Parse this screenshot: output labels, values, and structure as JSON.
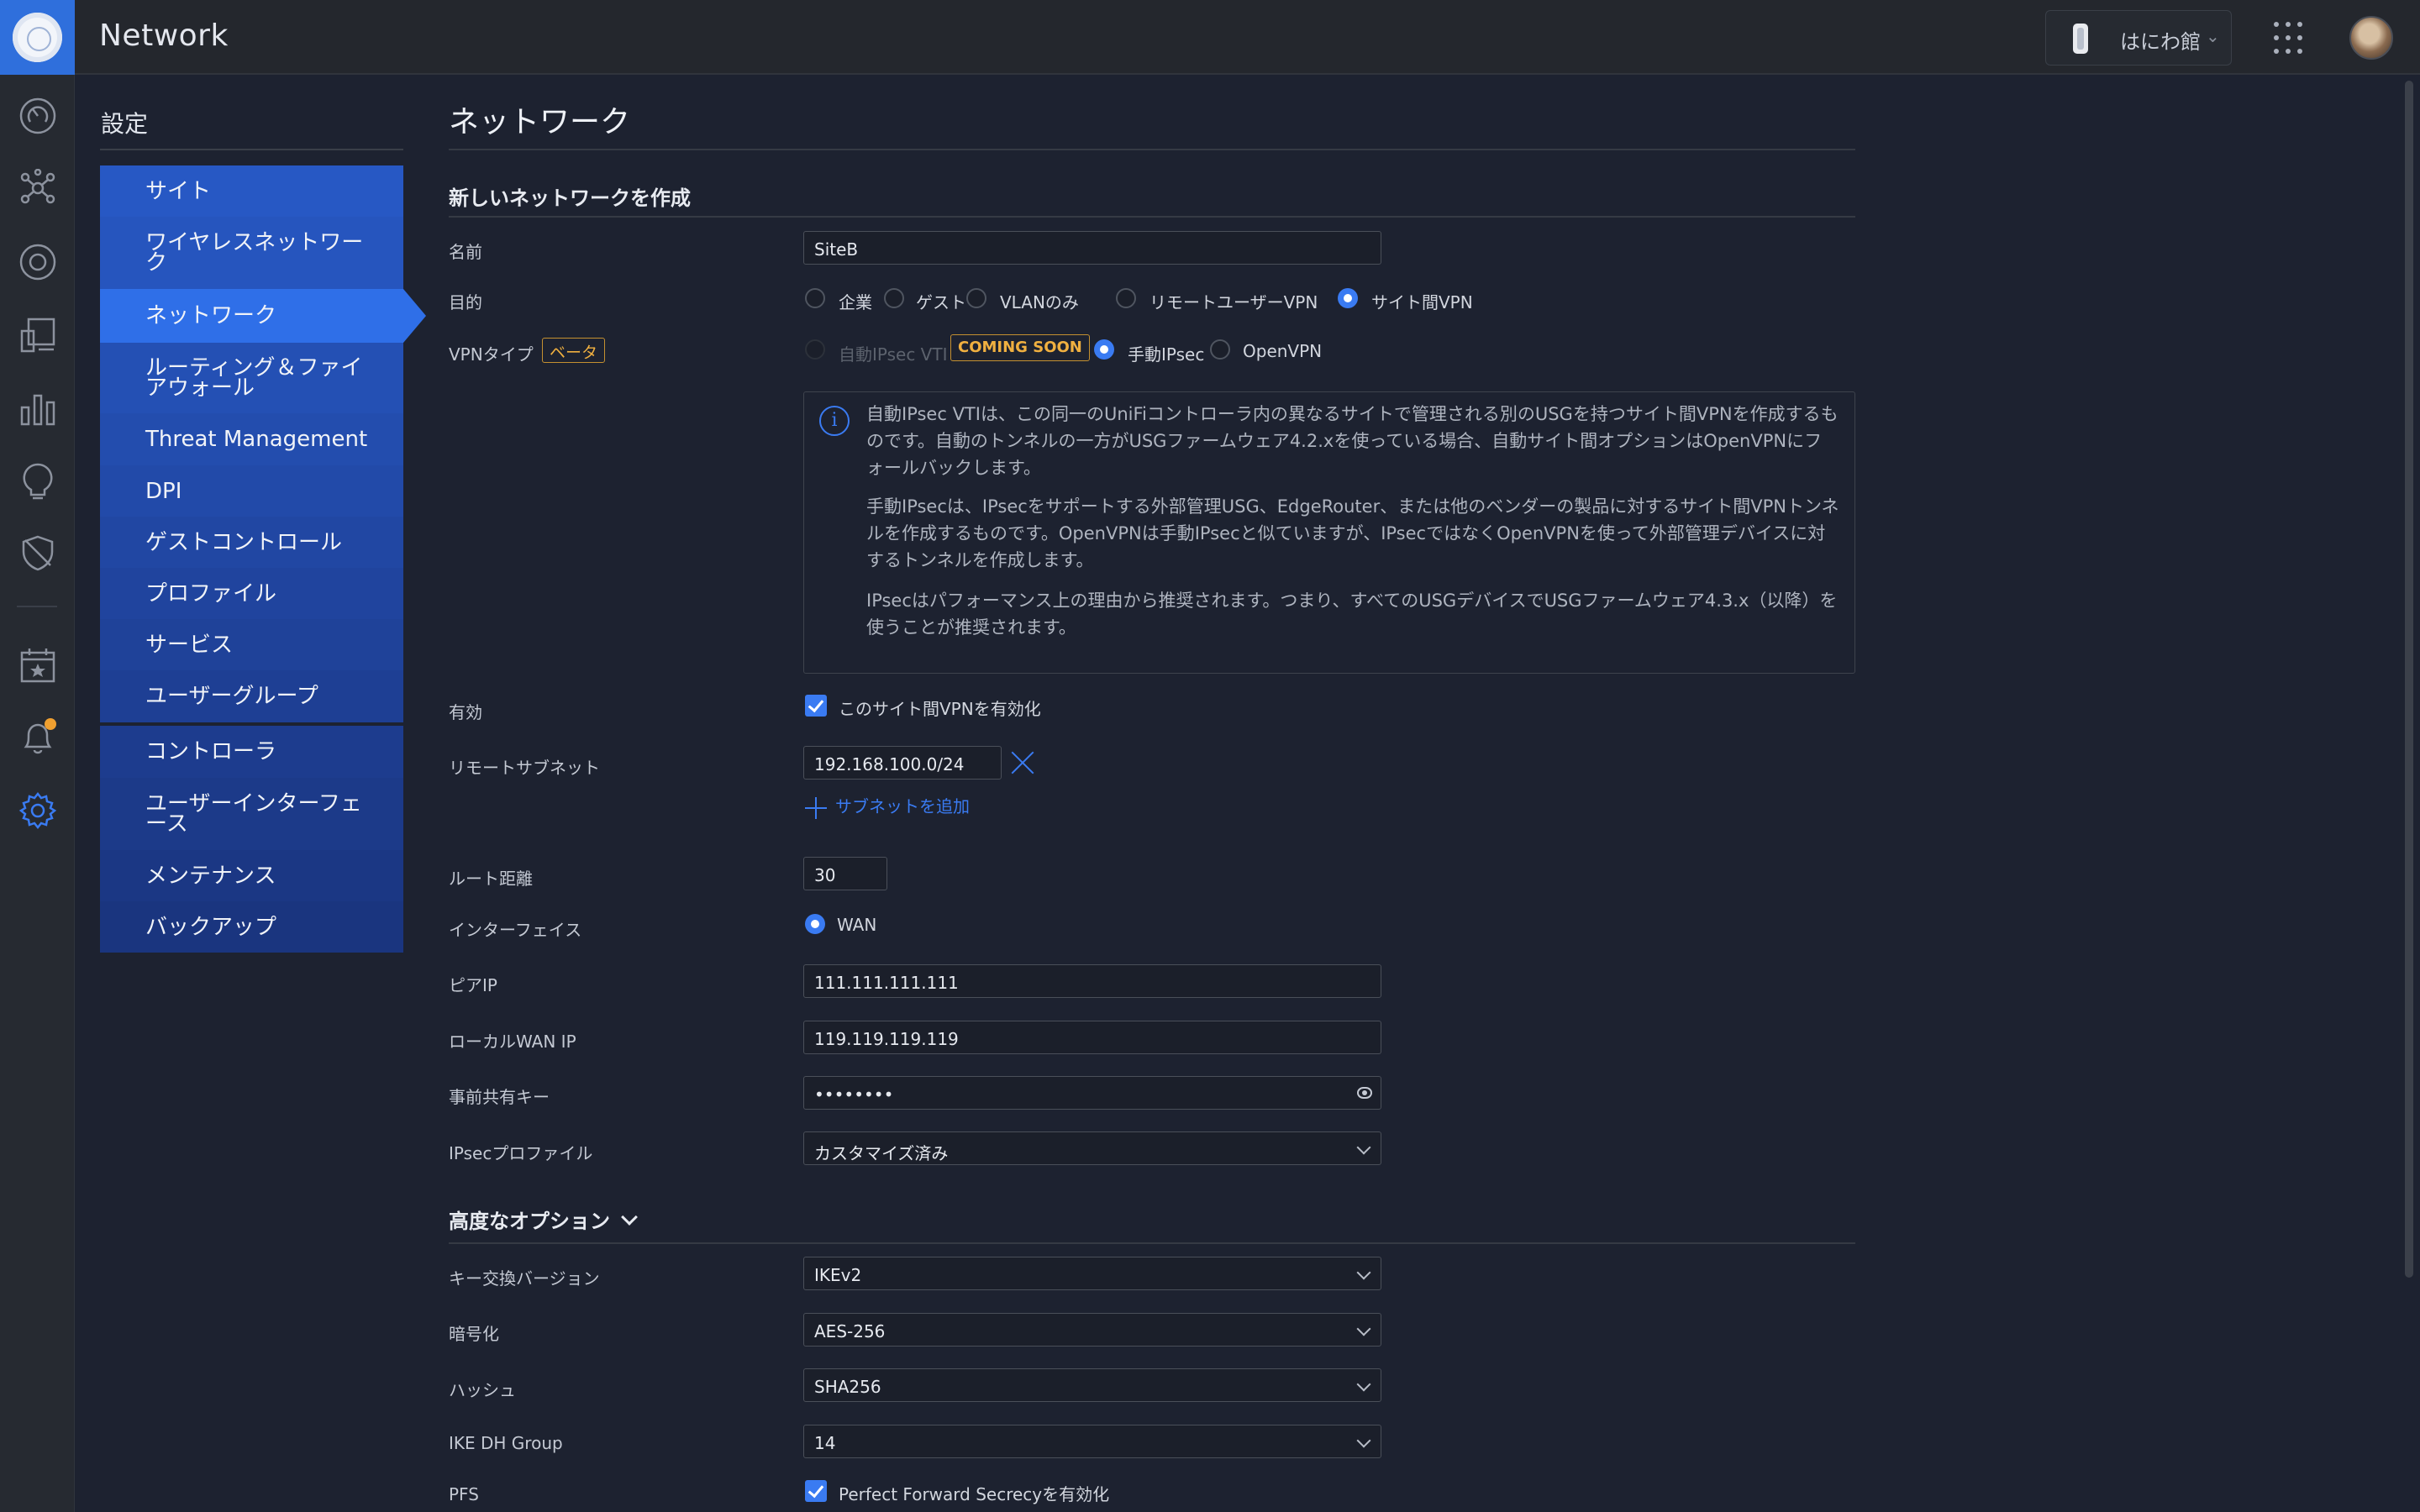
{
  "app": {
    "title": "Network"
  },
  "header": {
    "site_name": "はにわ館",
    "site_chevron": "⌄"
  },
  "settings": {
    "title": "設定"
  },
  "menu": {
    "group1": [
      {
        "label": "サイト"
      },
      {
        "label": "ワイヤレスネットワーク"
      },
      {
        "label": "ネットワーク",
        "active": true
      },
      {
        "label": "ルーティング＆ファイアウォール"
      },
      {
        "label": "Threat Management"
      },
      {
        "label": "DPI"
      },
      {
        "label": "ゲストコントロール"
      },
      {
        "label": "プロファイル"
      },
      {
        "label": "サービス"
      },
      {
        "label": "ユーザーグループ"
      }
    ],
    "group2": [
      {
        "label": "コントローラ"
      },
      {
        "label": "ユーザーインターフェース"
      },
      {
        "label": "メンテナンス"
      },
      {
        "label": "バックアップ"
      }
    ]
  },
  "page": {
    "title": "ネットワーク",
    "section_title": "新しいネットワークを作成"
  },
  "form": {
    "name": {
      "label": "名前",
      "value": "SiteB"
    },
    "purpose": {
      "label": "目的",
      "options": [
        "企業",
        "ゲスト",
        "VLANのみ",
        "リモートユーザーVPN",
        "サイト間VPN"
      ],
      "selected": "サイト間VPN"
    },
    "vpn_type": {
      "label": "VPNタイプ",
      "beta": "ベータ",
      "options": [
        "自動IPsec VTI",
        "手動IPsec",
        "OpenVPN"
      ],
      "coming_soon": "COMING SOON",
      "selected": "手動IPsec"
    },
    "info": {
      "p1": "自動IPsec VTIは、この同一のUniFiコントローラ内の異なるサイトで管理される別のUSGを持つサイト間VPNを作成するものです。自動のトンネルの一方がUSGファームウェア4.2.xを使っている場合、自動サイト間オプションはOpenVPNにフォールバックします。",
      "p2": "手動IPsecは、IPsecをサポートする外部管理USG、EdgeRouter、または他のベンダーの製品に対するサイト間VPNトンネルを作成するものです。OpenVPNは手動IPsecと似ていますが、IPsecではなくOpenVPNを使って外部管理デバイスに対するトンネルを作成します。",
      "p3": "IPsecはパフォーマンス上の理由から推奨されます。つまり、すべてのUSGデバイスでUSGファームウェア4.3.x（以降）を使うことが推奨されます。"
    },
    "enabled": {
      "label": "有効",
      "checkbox_label": "このサイト間VPNを有効化",
      "checked": true
    },
    "remote_subnet": {
      "label": "リモートサブネット",
      "value": "192.168.100.0/24",
      "add_label": "サブネットを追加"
    },
    "route_distance": {
      "label": "ルート距離",
      "value": "30"
    },
    "interface": {
      "label": "インターフェイス",
      "option": "WAN"
    },
    "peer_ip": {
      "label": "ピアIP",
      "value": "111.111.111.111"
    },
    "local_wan_ip": {
      "label": "ローカルWAN IP",
      "value": "119.119.119.119"
    },
    "psk": {
      "label": "事前共有キー",
      "value": "••••••••"
    },
    "ipsec_profile": {
      "label": "IPsecプロファイル",
      "value": "カスタマイズ済み"
    }
  },
  "advanced": {
    "title": "高度なオプション",
    "key_exchange": {
      "label": "キー交換バージョン",
      "value": "IKEv2"
    },
    "encryption": {
      "label": "暗号化",
      "value": "AES-256"
    },
    "hash": {
      "label": "ハッシュ",
      "value": "SHA256"
    },
    "dh_group": {
      "label": "IKE DH Group",
      "value": "14"
    },
    "pfs": {
      "label": "PFS",
      "checkbox_label": "Perfect Forward Secrecyを有効化",
      "checked": true
    }
  },
  "colors": {
    "accent": "#3a7bf2",
    "menu_blue": "#2452b8",
    "menu_active": "#2f6fe8",
    "warning": "#f0b040"
  }
}
